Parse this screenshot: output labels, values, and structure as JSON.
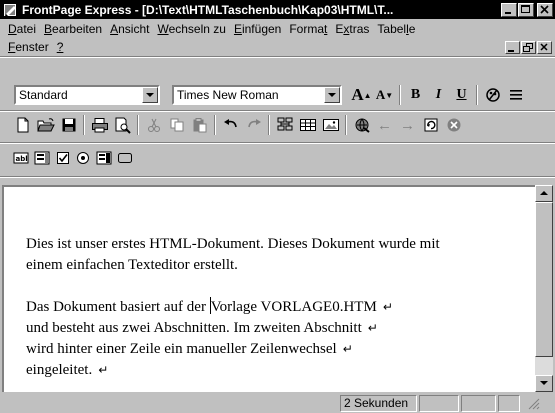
{
  "window": {
    "title": "FrontPage Express - [D:\\Text\\HTMLTaschenbuch\\Kap03\\HTML\\T..."
  },
  "menu": {
    "row1": [
      {
        "label": "Datei",
        "key": "D",
        "rest": "atei"
      },
      {
        "label": "Bearbeiten",
        "key": "B",
        "rest": "earbeiten"
      },
      {
        "label": "Ansicht",
        "key": "A",
        "rest": "nsicht"
      },
      {
        "label": "Wechseln zu",
        "key": "W",
        "rest": "echseln zu"
      },
      {
        "label": "Einfügen",
        "key": "E",
        "rest": "infügen"
      },
      {
        "label": "Format",
        "pre": "Forma",
        "key": "t",
        "rest": ""
      },
      {
        "label": "Extras",
        "pre": "E",
        "key": "x",
        "rest": "tras"
      },
      {
        "label": "Tabelle",
        "pre": "Tabel",
        "key": "l",
        "rest": "e"
      }
    ],
    "row2": [
      {
        "label": "Fenster",
        "key": "F",
        "rest": "enster"
      },
      {
        "label": "?",
        "key": "?",
        "rest": ""
      }
    ]
  },
  "format_toolbar": {
    "style": "Standard",
    "font": "Times New Roman",
    "increase_font": "A",
    "decrease_font": "A",
    "bold": "B",
    "italic": "I",
    "underline": "U"
  },
  "document": {
    "paragraphs": [
      [
        "Dies ist unser erstes HTML-Dokument. Dieses Dokument wurde mit",
        "einem einfachen Texteditor erstellt."
      ],
      [
        "Das Dokument basiert auf der |Vorlage VORLAGE0.HTM",
        "und besteht aus zwei Abschnitten. Im zweiten Abschnitt",
        "wird hinter einer Zeile ein manueller Zeilenwechsel",
        "eingeleitet."
      ]
    ],
    "para2_line1_before": "Das Dokument basiert auf der ",
    "para2_line1_after": "Vorlage VORLAGE0.HTM",
    "line_break_symbol": "↵"
  },
  "status": {
    "time": "2 Sekunden"
  },
  "icons": {
    "new": "new-document-icon",
    "open": "open-folder-icon",
    "save": "save-disk-icon",
    "print": "print-icon",
    "preview": "print-preview-icon",
    "cut": "cut-icon",
    "copy": "copy-icon",
    "paste": "paste-icon",
    "undo": "undo-icon",
    "redo": "redo-icon"
  }
}
